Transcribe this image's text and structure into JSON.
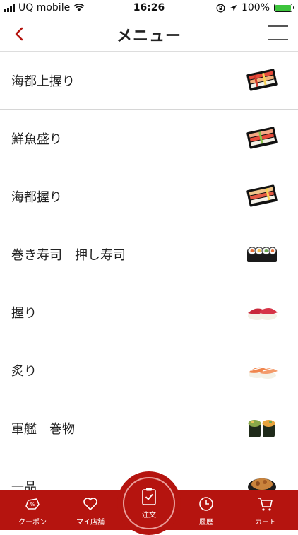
{
  "status": {
    "carrier": "UQ mobile",
    "time": "16:26",
    "battery": "100%"
  },
  "header": {
    "title": "メニュー"
  },
  "menu": [
    {
      "label": "海都上握り",
      "icon": "sushi-platter-icon"
    },
    {
      "label": "鮮魚盛り",
      "icon": "sushi-platter-icon"
    },
    {
      "label": "海都握り",
      "icon": "sushi-platter-icon"
    },
    {
      "label": "巻き寿司　押し寿司",
      "icon": "sushi-roll-icon"
    },
    {
      "label": "握り",
      "icon": "tuna-nigiri-icon"
    },
    {
      "label": "炙り",
      "icon": "shrimp-nigiri-icon"
    },
    {
      "label": "軍艦　巻物",
      "icon": "gunkan-icon"
    },
    {
      "label": "一品",
      "icon": "side-dish-icon"
    }
  ],
  "tabs": {
    "coupon": "クーポン",
    "mystore": "マイ店舗",
    "order": "注文",
    "history": "履歴",
    "cart": "カート"
  },
  "colors": {
    "accent": "#b5140f",
    "battery": "#3cc43c"
  }
}
